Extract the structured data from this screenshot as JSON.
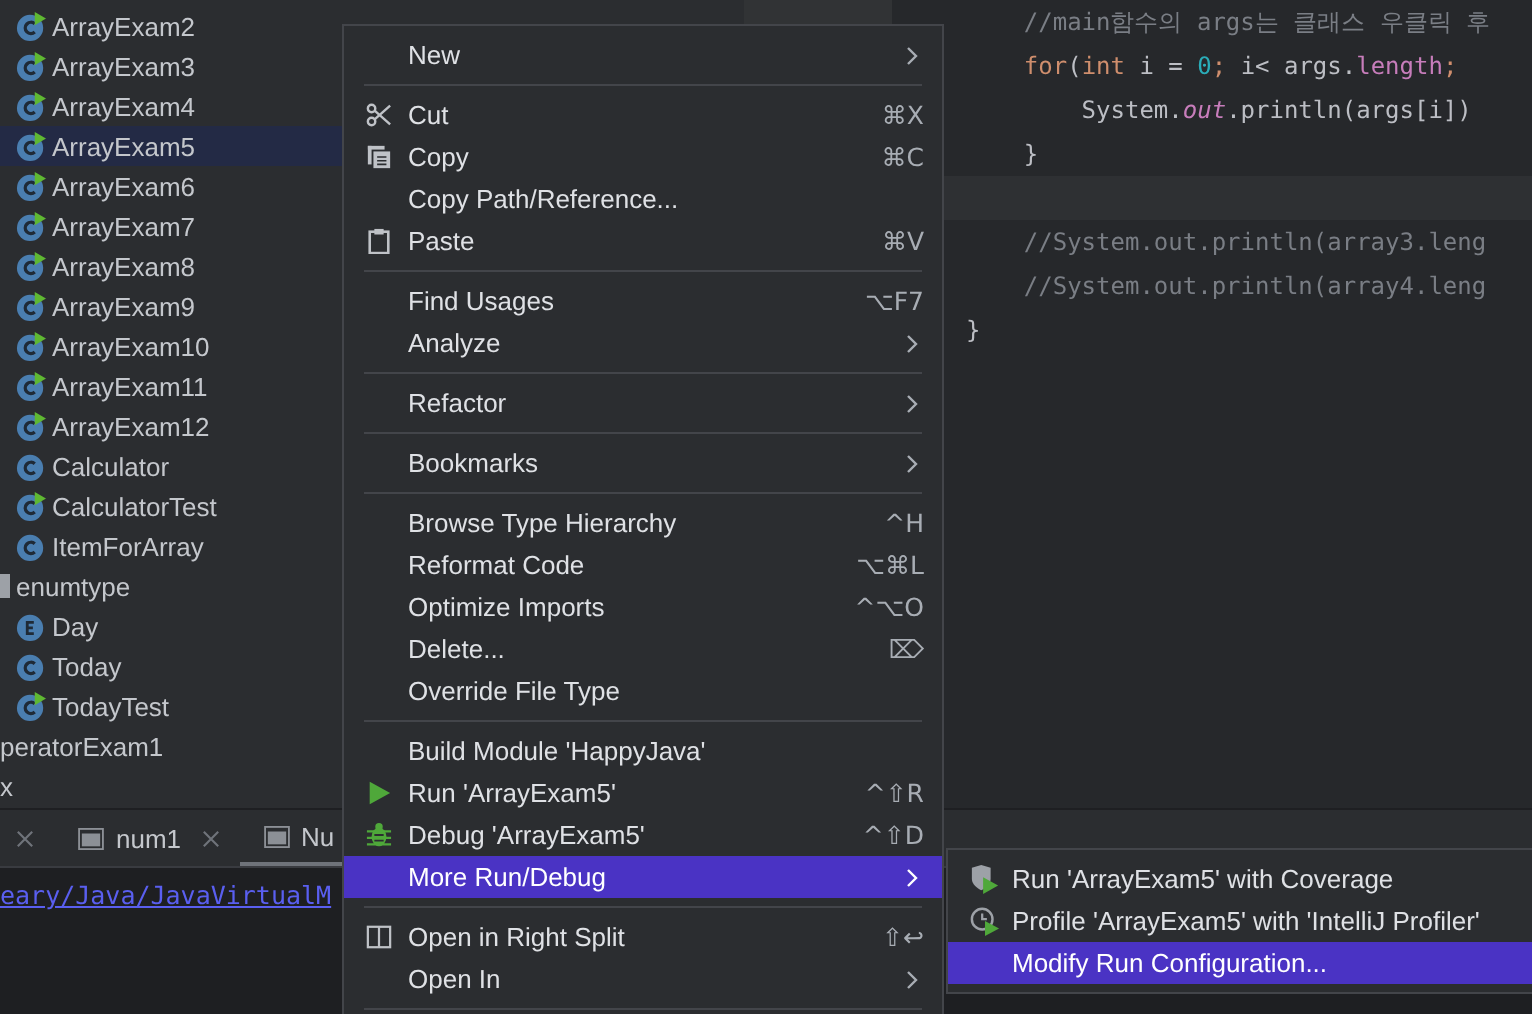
{
  "project_tree": [
    {
      "label": "ArrayExam2",
      "kind": "runnable-class",
      "selected": false
    },
    {
      "label": "ArrayExam3",
      "kind": "runnable-class",
      "selected": false
    },
    {
      "label": "ArrayExam4",
      "kind": "runnable-class",
      "selected": false
    },
    {
      "label": "ArrayExam5",
      "kind": "runnable-class",
      "selected": true
    },
    {
      "label": "ArrayExam6",
      "kind": "runnable-class",
      "selected": false
    },
    {
      "label": "ArrayExam7",
      "kind": "runnable-class",
      "selected": false
    },
    {
      "label": "ArrayExam8",
      "kind": "runnable-class",
      "selected": false
    },
    {
      "label": "ArrayExam9",
      "kind": "runnable-class",
      "selected": false
    },
    {
      "label": "ArrayExam10",
      "kind": "runnable-class",
      "selected": false
    },
    {
      "label": "ArrayExam11",
      "kind": "runnable-class",
      "selected": false
    },
    {
      "label": "ArrayExam12",
      "kind": "runnable-class",
      "selected": false
    },
    {
      "label": "Calculator",
      "kind": "class",
      "selected": false
    },
    {
      "label": "CalculatorTest",
      "kind": "runnable-class",
      "selected": false
    },
    {
      "label": "ItemForArray",
      "kind": "class",
      "selected": false
    },
    {
      "label": "enumtype",
      "kind": "package",
      "selected": false,
      "children": [
        {
          "label": "Day",
          "kind": "enum",
          "selected": false
        },
        {
          "label": "Today",
          "kind": "class",
          "selected": false
        },
        {
          "label": "TodayTest",
          "kind": "runnable-class",
          "selected": false
        }
      ]
    },
    {
      "label": "peratorExam1",
      "kind": "text",
      "selected": false
    },
    {
      "label": "x",
      "kind": "text",
      "selected": false
    }
  ],
  "editor": {
    "lines": [
      {
        "tokens": [
          {
            "text": "    //main함수의 args는 클래스 우클릭 후",
            "kind": "comment"
          }
        ]
      },
      {
        "tokens": [
          {
            "text": "    for",
            "kind": "keyword"
          },
          {
            "text": "(",
            "kind": "plain"
          },
          {
            "text": "int",
            "kind": "keyword"
          },
          {
            "text": " i = ",
            "kind": "plain"
          },
          {
            "text": "0",
            "kind": "number"
          },
          {
            "text": "; ",
            "kind": "keyword"
          },
          {
            "text": "i< args.",
            "kind": "plain"
          },
          {
            "text": "length",
            "kind": "field"
          },
          {
            "text": ";",
            "kind": "keyword"
          }
        ]
      },
      {
        "tokens": [
          {
            "text": "        System.",
            "kind": "plain"
          },
          {
            "text": "out",
            "kind": "static"
          },
          {
            "text": ".println(args[i])",
            "kind": "plain"
          }
        ]
      },
      {
        "tokens": [
          {
            "text": "    }",
            "kind": "plain"
          }
        ]
      },
      {
        "current": true
      },
      {
        "tokens": [
          {
            "text": "    //System.out.println(array3.leng",
            "kind": "comment"
          }
        ]
      },
      {
        "tokens": [
          {
            "text": "    //System.out.println(array4.leng",
            "kind": "comment"
          }
        ]
      },
      {
        "tokens": [
          {
            "text": "}",
            "kind": "plain"
          }
        ]
      }
    ]
  },
  "bottom_panel": {
    "tabs": [
      {
        "label": "num1",
        "selected": false
      },
      {
        "label": "Nu",
        "selected": true
      }
    ],
    "output_link": "eary/Java/JavaVirtualM"
  },
  "context_menu": {
    "items": [
      {
        "kind": "item",
        "label": "New",
        "submenu": true,
        "selected": false
      },
      {
        "kind": "separator"
      },
      {
        "kind": "item",
        "label": "Cut",
        "shortcut": "⌘X",
        "selected": false
      },
      {
        "kind": "item",
        "label": "Copy",
        "shortcut": "⌘C",
        "selected": false
      },
      {
        "kind": "item",
        "label": "Copy Path/Reference...",
        "selected": false
      },
      {
        "kind": "item",
        "label": "Paste",
        "shortcut": "⌘V",
        "selected": false
      },
      {
        "kind": "separator"
      },
      {
        "kind": "item",
        "label": "Find Usages",
        "shortcut": "⌥F7",
        "selected": false
      },
      {
        "kind": "item",
        "label": "Analyze",
        "submenu": true,
        "selected": false
      },
      {
        "kind": "separator"
      },
      {
        "kind": "item",
        "label": "Refactor",
        "submenu": true,
        "selected": false
      },
      {
        "kind": "separator"
      },
      {
        "kind": "item",
        "label": "Bookmarks",
        "submenu": true,
        "selected": false
      },
      {
        "kind": "separator"
      },
      {
        "kind": "item",
        "label": "Browse Type Hierarchy",
        "shortcut": "^H",
        "selected": false
      },
      {
        "kind": "item",
        "label": "Reformat Code",
        "shortcut": "⌥⌘L",
        "selected": false
      },
      {
        "kind": "item",
        "label": "Optimize Imports",
        "shortcut": "^⌥O",
        "selected": false
      },
      {
        "kind": "item",
        "label": "Delete...",
        "shortcut": "⌦",
        "selected": false
      },
      {
        "kind": "item",
        "label": "Override File Type",
        "selected": false
      },
      {
        "kind": "separator"
      },
      {
        "kind": "item",
        "label": "Build Module 'HappyJava'",
        "selected": false
      },
      {
        "kind": "item",
        "label": "Run 'ArrayExam5'",
        "shortcut": "^⇧R",
        "selected": false
      },
      {
        "kind": "item",
        "label": "Debug 'ArrayExam5'",
        "shortcut": "^⇧D",
        "selected": false
      },
      {
        "kind": "item",
        "label": "More Run/Debug",
        "submenu": true,
        "selected": true
      },
      {
        "kind": "separator"
      },
      {
        "kind": "item",
        "label": "Open in Right Split",
        "shortcut": "⇧↩",
        "selected": false
      },
      {
        "kind": "item",
        "label": "Open In",
        "submenu": true,
        "selected": false
      },
      {
        "kind": "separator"
      }
    ]
  },
  "submenu": {
    "items": [
      {
        "label": "Run 'ArrayExam5' with Coverage",
        "selected": false
      },
      {
        "label": "Profile 'ArrayExam5' with 'IntelliJ Profiler'",
        "selected": false
      },
      {
        "label": "Modify Run Configuration...",
        "selected": true
      }
    ]
  }
}
